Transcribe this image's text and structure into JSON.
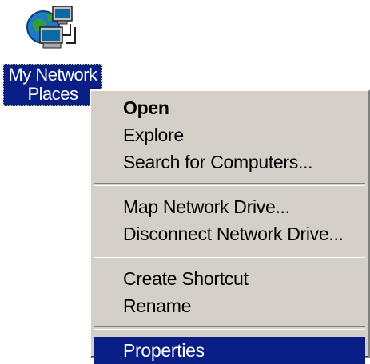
{
  "desktop": {
    "icon": {
      "name": "network-places-icon",
      "label_line1": "My Network",
      "label_line2": "Places"
    }
  },
  "context_menu": {
    "items": [
      {
        "label": "Open",
        "default": true
      },
      {
        "label": "Explore"
      },
      {
        "label": "Search for Computers..."
      },
      {
        "label": "Map Network Drive..."
      },
      {
        "label": "Disconnect Network Drive..."
      },
      {
        "label": "Create Shortcut"
      },
      {
        "label": "Rename"
      },
      {
        "label": "Properties",
        "selected": true
      }
    ]
  },
  "colors": {
    "selection_blue": "#0a1f86",
    "menu_gray": "#d4d0c8"
  }
}
